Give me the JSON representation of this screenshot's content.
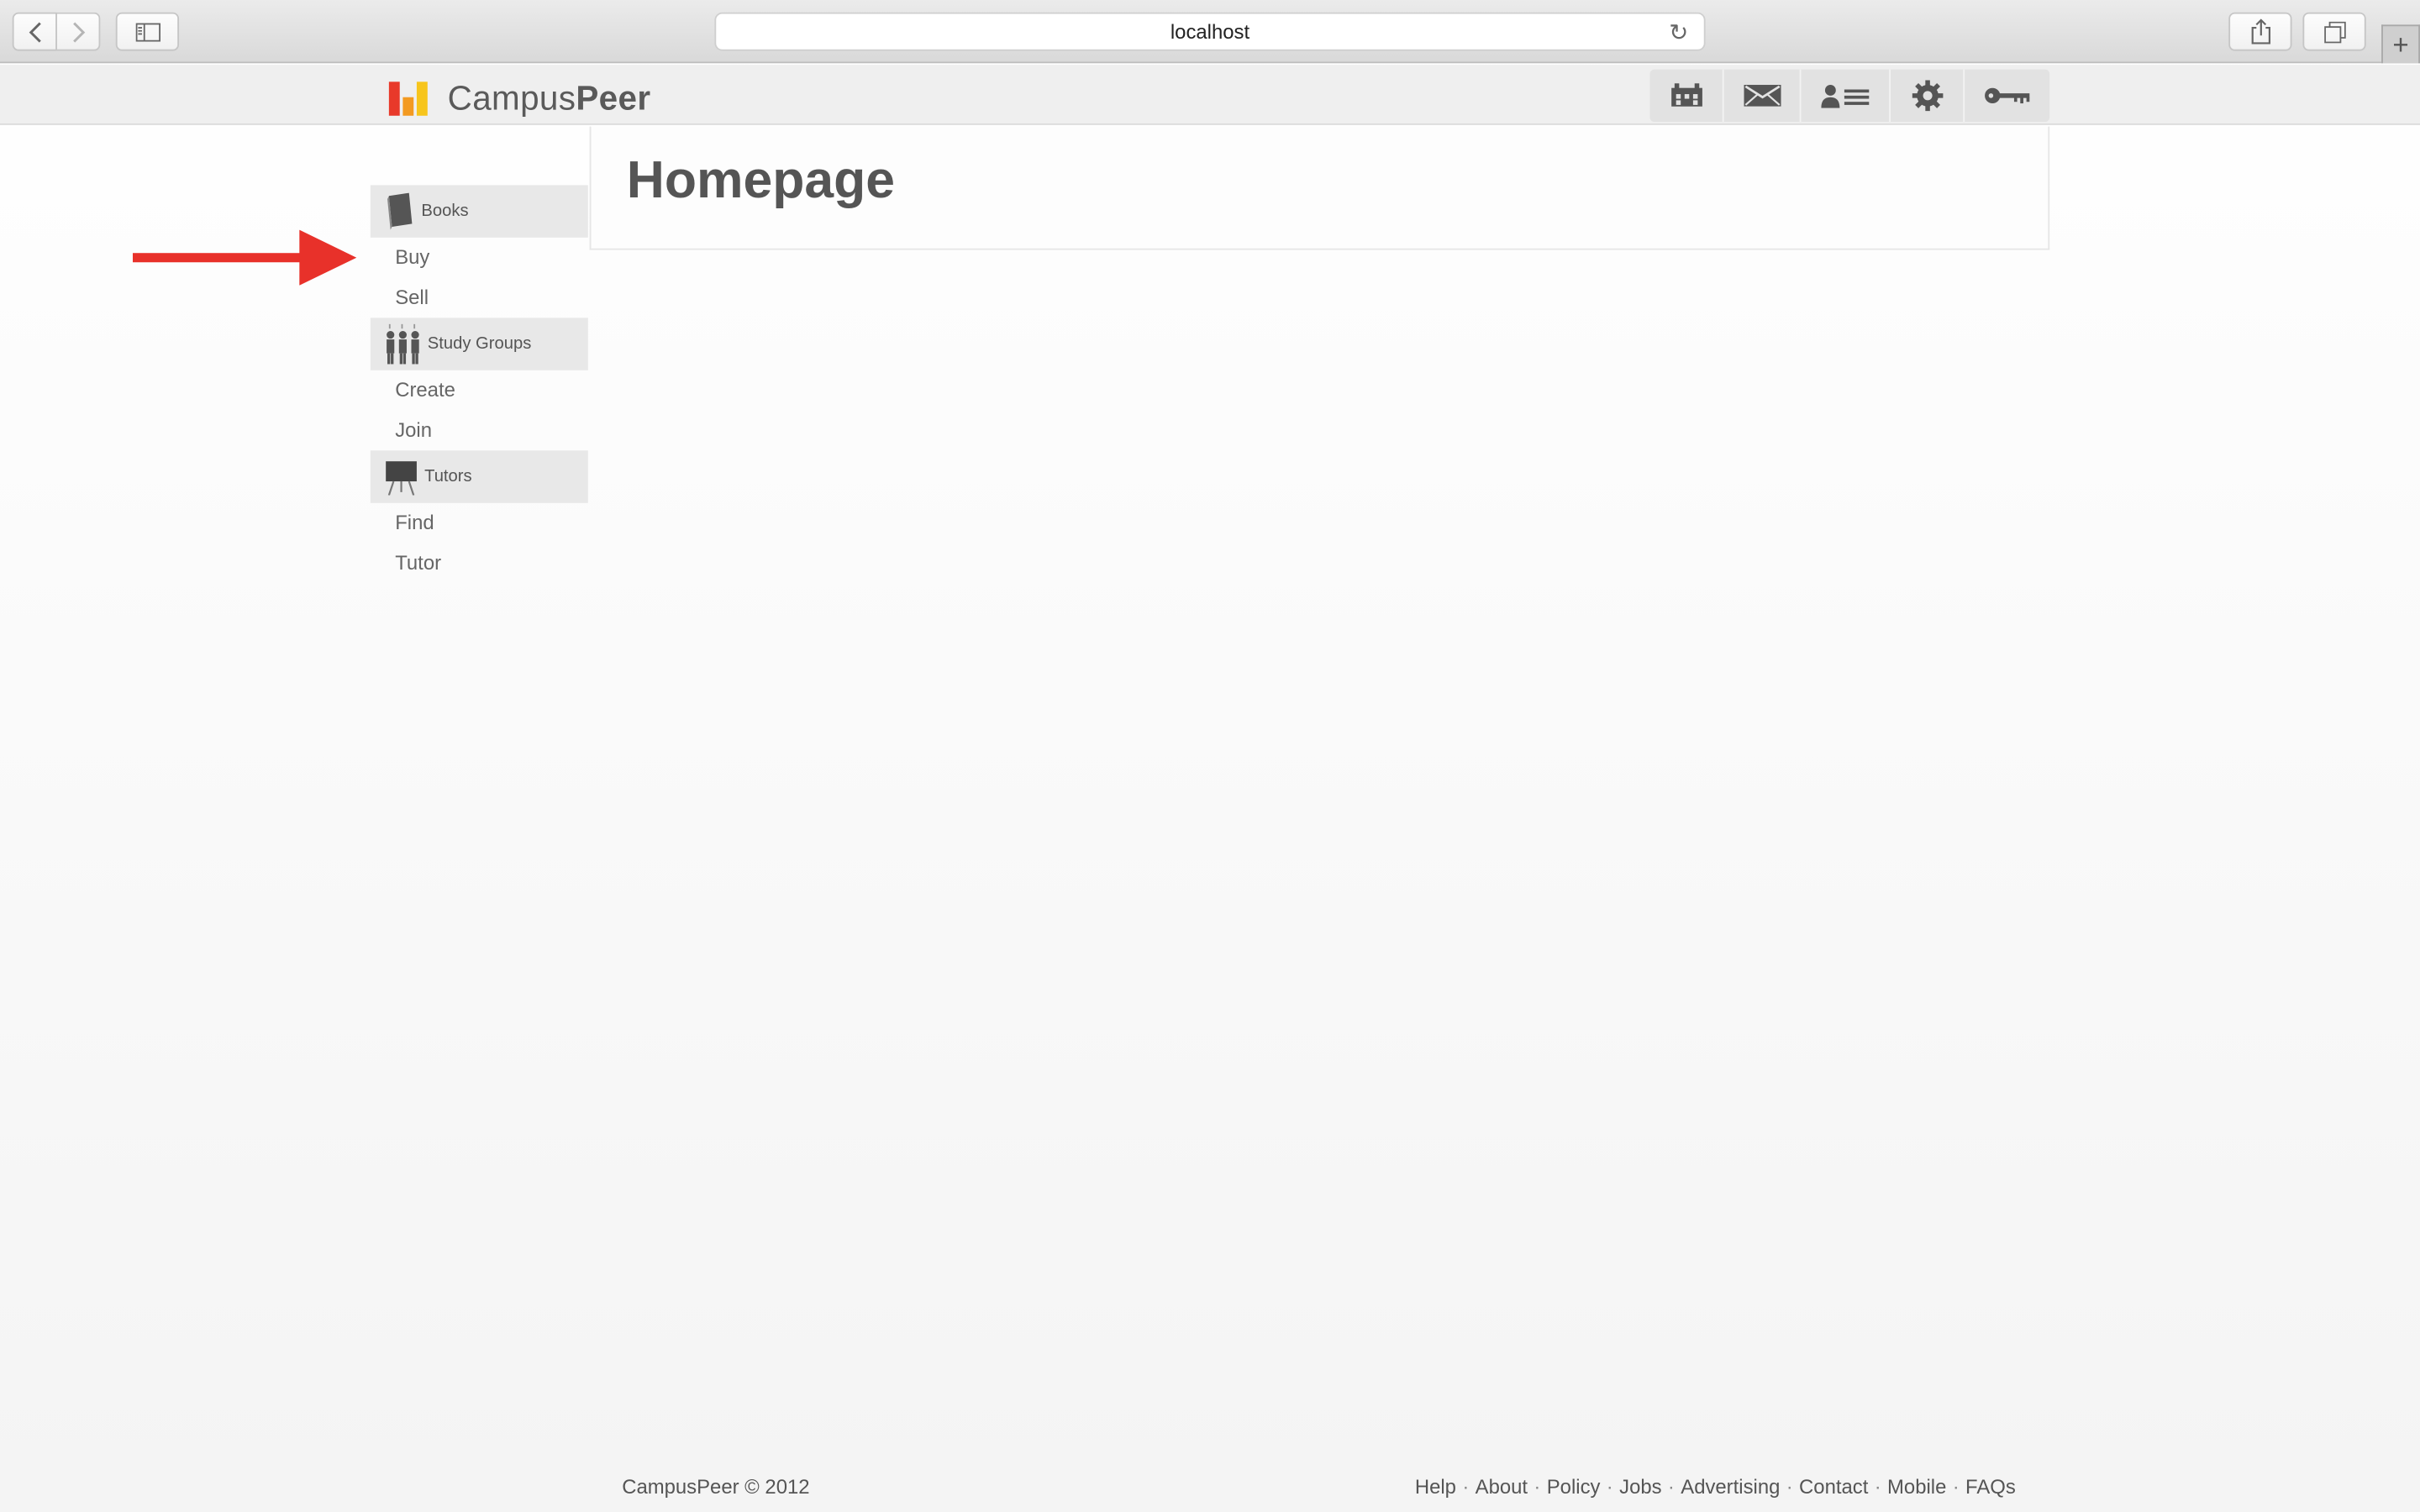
{
  "browser": {
    "url": "localhost"
  },
  "site": {
    "logo_parts": [
      "Campus",
      "Peer"
    ],
    "header_icons": [
      "calendar-icon",
      "mail-icon",
      "profile-list-icon",
      "gear-icon",
      "key-icon"
    ]
  },
  "sidebar": {
    "sections": [
      {
        "label": "Books",
        "icon": "book-icon",
        "items": [
          "Buy",
          "Sell"
        ]
      },
      {
        "label": "Study Groups",
        "icon": "people-icon",
        "items": [
          "Create",
          "Join"
        ]
      },
      {
        "label": "Tutors",
        "icon": "easel-icon",
        "items": [
          "Find",
          "Tutor"
        ]
      }
    ]
  },
  "main": {
    "title": "Homepage"
  },
  "annotation": {
    "arrow_color": "#e8312a"
  },
  "footer": {
    "copyright": "CampusPeer © 2012",
    "links": [
      "Help",
      "About",
      "Policy",
      "Jobs",
      "Advertising",
      "Contact",
      "Mobile",
      "FAQs"
    ]
  }
}
